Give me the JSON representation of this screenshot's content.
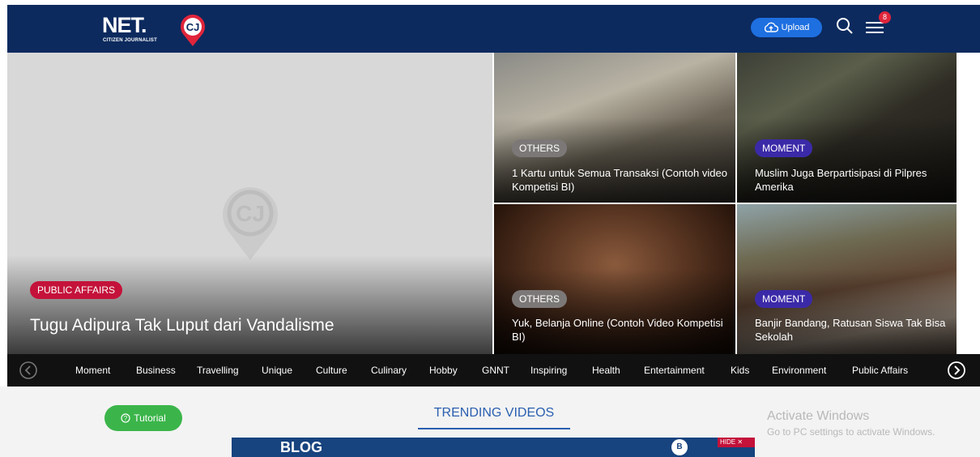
{
  "header": {
    "logo_text": "NET.",
    "logo_sub": "CITIZEN JOURNALIST",
    "upload_label": "Upload",
    "notification_count": "8"
  },
  "hero": {
    "category": "PUBLIC AFFAIRS",
    "title": "Tugu Adipura Tak Luput dari Vandalisme"
  },
  "tiles": [
    {
      "category": "OTHERS",
      "title": "1 Kartu untuk Semua Transaksi (Contoh video Kompetisi BI)"
    },
    {
      "category": "MOMENT",
      "title": "Muslim Juga Berpartisipasi di Pilpres Amerika"
    },
    {
      "category": "OTHERS",
      "title": "Yuk, Belanja Online (Contoh Video Kompetisi BI)"
    },
    {
      "category": "MOMENT",
      "title": "Banjir Bandang, Ratusan Siswa Tak Bisa Sekolah"
    }
  ],
  "nav": {
    "items": [
      "Moment",
      "Business",
      "Travelling",
      "Unique",
      "Culture",
      "Culinary",
      "Hobby",
      "GNNT",
      "Inspiring",
      "Health",
      "Entertainment",
      "Kids",
      "Environment",
      "Public Affairs"
    ]
  },
  "tutorial_label": "Tutorial",
  "trending_label": "TRENDING VIDEOS",
  "banner": {
    "text": "BLOG",
    "hide_label": "HIDE"
  },
  "windows_notice": {
    "title": "Activate Windows",
    "subtitle": "Go to PC settings to activate Windows."
  },
  "colors": {
    "header_bg": "#0c2a5e",
    "accent_blue": "#1e6fe0",
    "public_affairs": "#c4123a",
    "moment": "#3b2aa8",
    "others": "#7c7878",
    "tutorial": "#3bb54a"
  }
}
